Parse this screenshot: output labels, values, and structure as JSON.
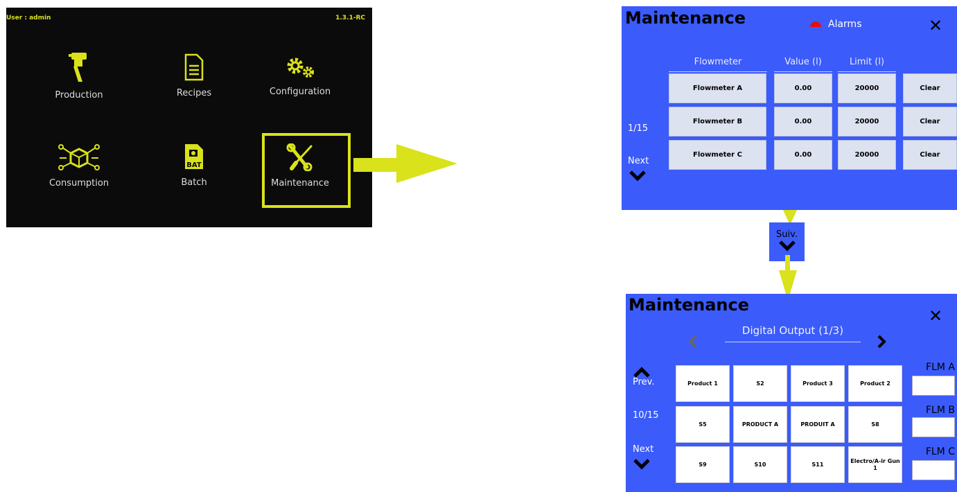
{
  "home": {
    "user_label": "User : admin",
    "version": "1.3.1-RC",
    "tiles": [
      {
        "label": "Production",
        "icon": "spray-gun-icon"
      },
      {
        "label": "Recipes",
        "icon": "document-icon"
      },
      {
        "label": "Configuration",
        "icon": "gears-icon"
      },
      {
        "label": "Consumption",
        "icon": "network-cube-icon"
      },
      {
        "label": "Batch",
        "icon": "bat-file-icon"
      },
      {
        "label": "Maintenance",
        "icon": "wrench-screwdriver-icon"
      }
    ],
    "highlight_color": "#d9e21a"
  },
  "flowmeter_screen": {
    "title": "Maintenance",
    "alarms_label": "Alarms",
    "close_icon": "close-icon",
    "columns": [
      "Flowmeter",
      "Value (l)",
      "Limit (l)"
    ],
    "rows": [
      {
        "name": "Flowmeter A",
        "value": "0.00",
        "limit": "20000",
        "action": "Clear"
      },
      {
        "name": "Flowmeter B",
        "value": "0.00",
        "limit": "20000",
        "action": "Clear"
      },
      {
        "name": "Flowmeter C",
        "value": "0.00",
        "limit": "20000",
        "action": "Clear"
      }
    ],
    "page": "1/15",
    "next_label": "Next"
  },
  "suiv_button": {
    "label": "Suiv."
  },
  "digital_output_screen": {
    "title": "Maintenance",
    "heading": "Digital Output (1/3)",
    "prev_label": "Prev.",
    "page": "10/15",
    "next_label": "Next",
    "grid": [
      [
        "Product 1",
        "S2",
        "Product 3",
        "Product 2"
      ],
      [
        "S5",
        "PRODUCT A",
        "PRODUIT A",
        "S8"
      ],
      [
        "S9",
        "S10",
        "S11",
        "Electro/A-ir Gun 1"
      ]
    ],
    "flowmeters": [
      "FLM A",
      "FLM B",
      "FLM C"
    ]
  },
  "colors": {
    "panel_blue": "#3b5bfa",
    "accent_yellow": "#d9e21a",
    "alarm_red": "#e01010"
  }
}
